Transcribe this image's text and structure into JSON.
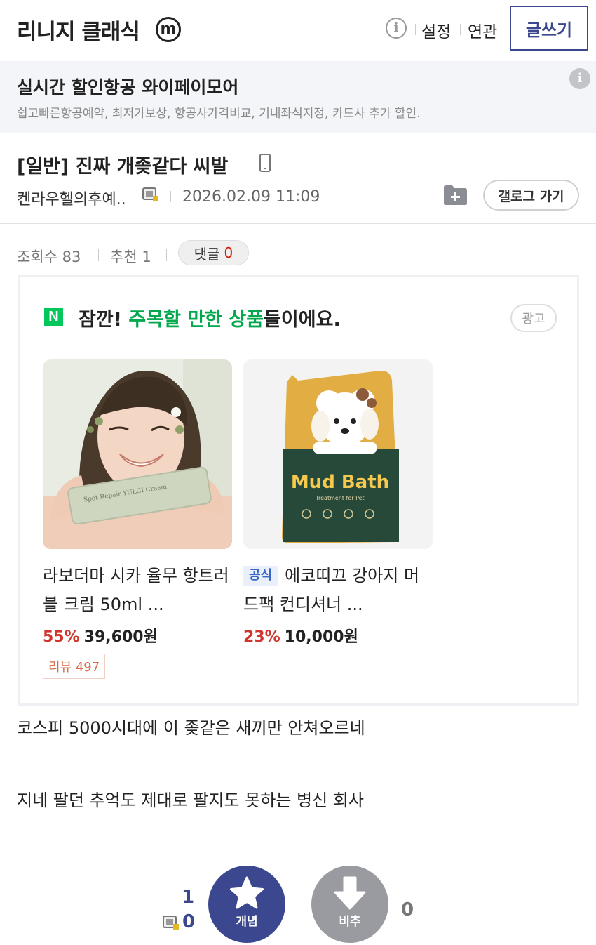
{
  "header": {
    "gallery_title": "리니지 클래식",
    "m_badge": "m",
    "info_icon": "i",
    "settings": "설정",
    "related": "연관",
    "write": "글쓰기"
  },
  "ad_banner": {
    "title": "실시간 할인항공 와이페이모어",
    "description": "쉽고빠른항공예약, 최저가보상, 항공사가격비교, 기내좌석지정, 카드사 추가 할인.",
    "info_icon": "i"
  },
  "post": {
    "title": "[일반] 진짜 개좆같다 씨발",
    "author": "켄라우헬의후예..",
    "date": "2026.02.09 11:09",
    "gallog_button": "갤로그 가기",
    "views_label": "조회수 83",
    "recommend_label": "추천 1",
    "comments_label": "댓글",
    "comments_count": "0",
    "body_lines": [
      "코스피 5000시대에 이 좆같은 새끼만 안쳐오르네",
      "지네 팔던 추억도 제대로 팔지도 못하는 병신 회사"
    ]
  },
  "shopping": {
    "logo": "N",
    "headline_prefix": "잠깐! ",
    "headline_highlight": "주목할 만한 상품",
    "headline_suffix": "들이에요.",
    "ad_tag": "광고",
    "products": [
      {
        "name": "라보더마 시카 율무 항트러블 크림 50ml ...",
        "discount": "55%",
        "price": "39,600원",
        "review": "리뷰 497",
        "image": "cream-model-photo",
        "tube_text": "Spot Repair YULCI Cream"
      },
      {
        "official_tag": "공식",
        "name": "에코띠끄 강아지 머드팩 컨디셔너 ...",
        "discount": "23%",
        "price": "10,000원",
        "image": "mud-bath-pouch",
        "pouch_title": "Mud Bath",
        "pouch_subtitle": "Treatment for Pet"
      }
    ]
  },
  "votes": {
    "up_count": "1",
    "up_fixed_count": "0",
    "up_label": "개념",
    "down_label": "비추",
    "down_count": "0"
  },
  "colors": {
    "accent": "#3b4890",
    "naver_green": "#03c75a",
    "discount_red": "#d0342c",
    "vote_up": "#3b4890",
    "vote_down": "#9a9ba1"
  }
}
